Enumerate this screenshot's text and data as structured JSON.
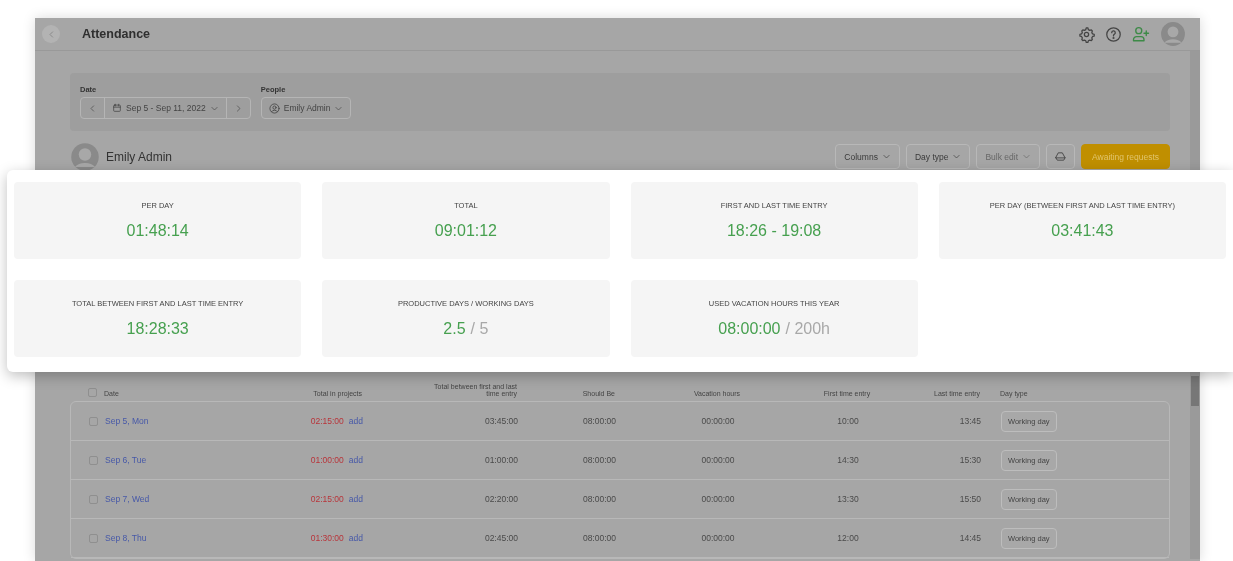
{
  "header": {
    "title": "Attendance"
  },
  "filters": {
    "date_label": "Date",
    "date_range": "Sep 5 - Sep 11, 2022",
    "people_label": "People",
    "person": "Emily Admin"
  },
  "user": {
    "name": "Emily Admin"
  },
  "toolbar": {
    "buttons": [
      {
        "label": "Columns",
        "kind": "dropdown",
        "disabled": false
      },
      {
        "label": "Day type",
        "kind": "dropdown",
        "disabled": false
      },
      {
        "label": "Bulk edit",
        "kind": "dropdown",
        "disabled": true
      },
      {
        "kind": "export"
      },
      {
        "label": "Awaiting requests",
        "kind": "primary"
      }
    ]
  },
  "stats": [
    {
      "label": "PER DAY",
      "value": "01:48:14"
    },
    {
      "label": "TOTAL",
      "value": "09:01:12"
    },
    {
      "label": "FIRST AND LAST TIME ENTRY",
      "value": "18:26 - 19:08"
    },
    {
      "label": "PER DAY (BETWEEN FIRST AND LAST TIME ENTRY)",
      "value": "03:41:43"
    },
    {
      "label": "TOTAL BETWEEN FIRST AND LAST TIME ENTRY",
      "value": "18:28:33"
    },
    {
      "label": "PRODUCTIVE DAYS / WORKING DAYS",
      "value": "2.5",
      "suffix": "/ 5"
    },
    {
      "label": "USED VACATION HOURS THIS YEAR",
      "value": "08:00:00",
      "suffix": "/ 200h"
    }
  ],
  "table": {
    "select_all": {
      "checked": false
    },
    "columns": [
      "Date",
      "Total in projects",
      "Total between first and last time entry",
      "Should Be",
      "Vacation hours",
      "First time entry",
      "Last time entry",
      "Day type"
    ],
    "rows": [
      {
        "checked": false,
        "date": "Sep 5, Mon",
        "projects": "02:15:00",
        "add": "add",
        "between": "03:45:00",
        "should_be": "08:00:00",
        "vacation": "00:00:00",
        "first": "10:00",
        "last": "13:45",
        "day_type": "Working day"
      },
      {
        "checked": false,
        "date": "Sep 6, Tue",
        "projects": "01:00:00",
        "add": "add",
        "between": "01:00:00",
        "should_be": "08:00:00",
        "vacation": "00:00:00",
        "first": "14:30",
        "last": "15:30",
        "day_type": "Working day"
      },
      {
        "checked": false,
        "date": "Sep 7, Wed",
        "projects": "02:15:00",
        "add": "add",
        "between": "02:20:00",
        "should_be": "08:00:00",
        "vacation": "00:00:00",
        "first": "13:30",
        "last": "15:50",
        "day_type": "Working day"
      },
      {
        "checked": false,
        "date": "Sep 8, Thu",
        "projects": "01:30:00",
        "add": "add",
        "between": "02:45:00",
        "should_be": "08:00:00",
        "vacation": "00:00:00",
        "first": "12:00",
        "last": "14:45",
        "day_type": "Working day"
      }
    ]
  }
}
